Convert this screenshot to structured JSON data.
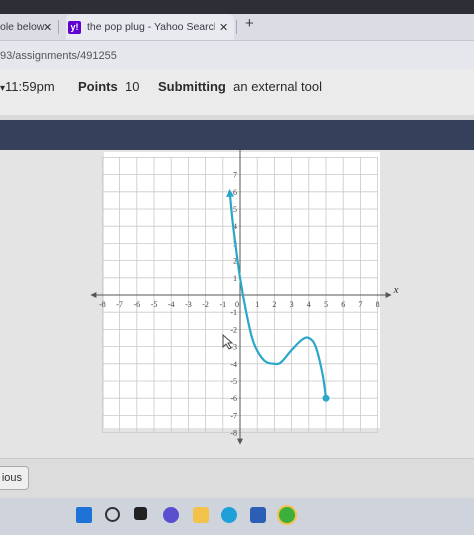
{
  "browser": {
    "tabs": [
      {
        "label": "ole below",
        "close": "✕"
      },
      {
        "label": "the pop plug - Yahoo Search Res",
        "close": "✕"
      }
    ],
    "new_tab": "+",
    "url": "93/assignments/491255"
  },
  "assignment": {
    "due_time": "11:59pm",
    "points_label": "Points",
    "points_value": "10",
    "submitting_label": "Submitting",
    "submitting_value": "an external tool"
  },
  "chart_data": {
    "type": "line",
    "xlabel": "x",
    "xlim": [
      -8,
      8
    ],
    "ylim": [
      -8,
      8
    ],
    "x_ticks": [
      "-8",
      "-7",
      "-6",
      "-5",
      "-4",
      "-3",
      "-2",
      "-1",
      "0",
      "1",
      "2",
      "3",
      "4",
      "5",
      "6",
      "7",
      "8"
    ],
    "y_ticks": [
      "7",
      "6",
      "5",
      "4",
      "3",
      "2",
      "1",
      "-1",
      "-2",
      "-3",
      "-4",
      "-5",
      "-6",
      "-7",
      "-8"
    ],
    "grid": true,
    "series": [
      {
        "color": "#2aa7c9",
        "x": [
          -0.6,
          -0.4,
          0,
          0.4,
          0.8,
          1.4,
          2,
          2.4,
          3,
          3.6,
          4,
          4.4,
          4.8,
          5
        ],
        "y": [
          6,
          4,
          1,
          -1.2,
          -2.8,
          -3.8,
          -4,
          -3.9,
          -3.2,
          -2.6,
          -2.5,
          -3,
          -4.6,
          -6
        ],
        "start": "arrow",
        "end": "closed-dot"
      }
    ]
  },
  "footer": {
    "previous_label": "ious"
  }
}
